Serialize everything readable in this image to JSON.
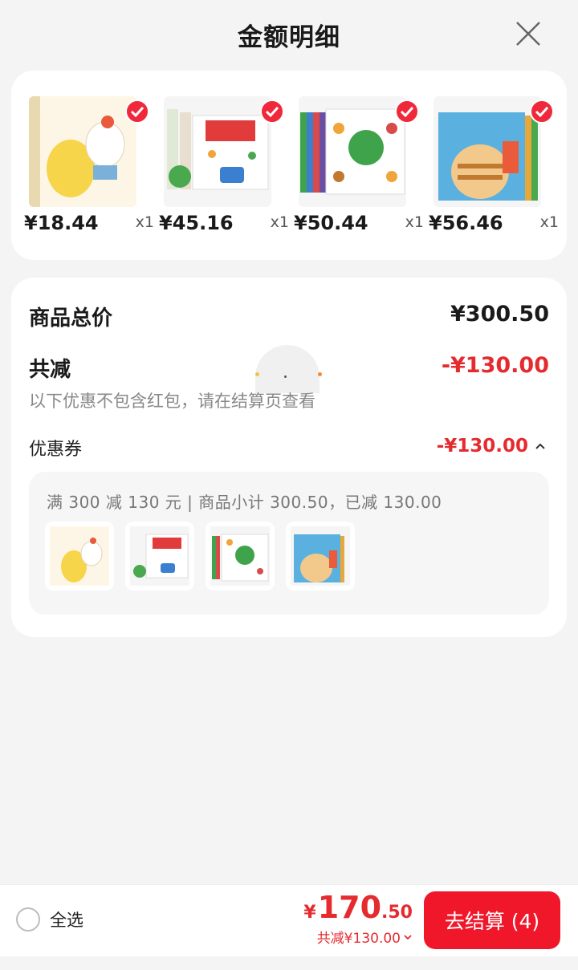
{
  "header": {
    "title": "金额明细"
  },
  "products": [
    {
      "price": "¥18.44",
      "qty": "x1",
      "colors": [
        "#f7d54a",
        "#ffffff",
        "#e85a3b",
        "#7bb0d8"
      ]
    },
    {
      "price": "¥45.16",
      "qty": "x1",
      "colors": [
        "#e23b3b",
        "#ffffff",
        "#4aa84f",
        "#3b7fd0"
      ]
    },
    {
      "price": "¥50.44",
      "qty": "x1",
      "colors": [
        "#3fa34b",
        "#ffffff",
        "#f0a43a",
        "#d94b4b"
      ]
    },
    {
      "price": "¥56.46",
      "qty": "x1",
      "colors": [
        "#5ab1e0",
        "#f3c98b",
        "#c0792f",
        "#e95b3b"
      ]
    }
  ],
  "details": {
    "subtotal_label": "商品总价",
    "subtotal_value": "¥300.50",
    "discount_label": "共减",
    "discount_value": "-¥130.00",
    "note": "以下优惠不包含红包，请在结算页查看",
    "coupon_label": "优惠券",
    "coupon_value": "-¥130.00",
    "coupon_desc": "满 300 减 130 元 | 商品小计 300.50，已减 130.00"
  },
  "bottom": {
    "select_all": "全选",
    "currency": "¥",
    "total_int": "170",
    "total_dec": ".50",
    "reduce_text": "共减¥130.00",
    "checkout_label": "去结算 (4)"
  },
  "accent": "#f0172b"
}
